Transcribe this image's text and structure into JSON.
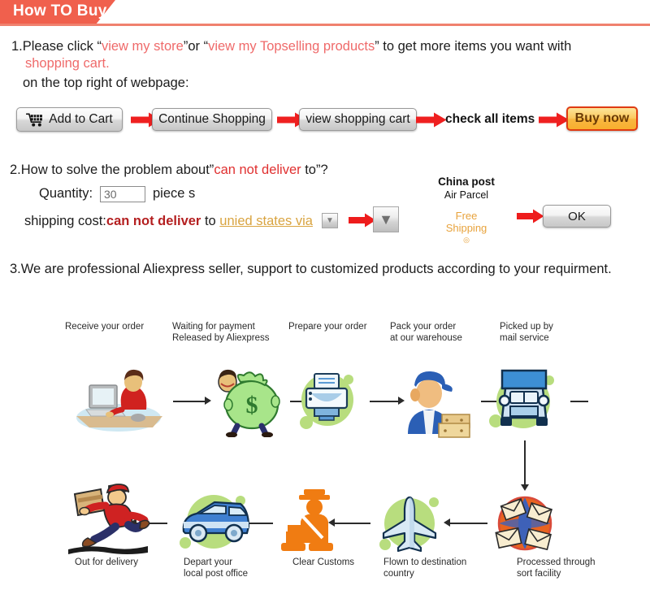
{
  "header": {
    "title": "How TO Buy",
    "accent_color": "#f0604d"
  },
  "step1": {
    "line1_a": "1.Please click “",
    "line1_link1": "view my store",
    "line1_b": "”or “",
    "line1_link2": "view my Topselling products",
    "line1_c": "” to get more items you want with",
    "line2_link": "shopping cart.",
    "line3": "on the top right of webpage:",
    "buttons": [
      {
        "label": "Add to Cart",
        "icon": "shopping-cart-icon",
        "style": "grey"
      },
      {
        "label": "Continue Shopping",
        "icon": "",
        "style": "grey"
      },
      {
        "label": "view shopping cart",
        "icon": "",
        "style": "grey"
      },
      {
        "label": "check all items",
        "icon": "",
        "style": "plain"
      },
      {
        "label": "Buy now",
        "icon": "",
        "style": "orange"
      }
    ]
  },
  "step2": {
    "heading_a": "2.How to solve the problem about”",
    "heading_red": "can not deliver",
    "heading_b": " to”?",
    "quantity_label": "Quantity:",
    "quantity_value": "30",
    "quantity_unit": "piece s",
    "shipping_label": "shipping cost:",
    "shipping_red": "can not deliver",
    "shipping_to": " to ",
    "shipping_country": "unied states via",
    "carrier_name": "China post",
    "carrier_service": "Air Parcel",
    "free_shipping_line1": "Free",
    "free_shipping_line2": "Shipping",
    "ok_button": "OK",
    "dropdown_glyph": "▼",
    "free_shipping_color": "#e8a33d"
  },
  "step3": {
    "text": "3.We are professional Aliexpress seller, support to customized products according to your requirment."
  },
  "flow": {
    "top_row": [
      {
        "label": "Receive your order",
        "icon": "person-at-computer-icon"
      },
      {
        "label": "Waiting for payment\nReleased by Aliexpress",
        "icon": "money-bag-icon"
      },
      {
        "label": "Prepare your order",
        "icon": "printer-icon"
      },
      {
        "label": "Pack your order\nat our warehouse",
        "icon": "warehouse-worker-icon"
      },
      {
        "label": "Picked up by\nmail service",
        "icon": "mail-truck-icon"
      }
    ],
    "bottom_row": [
      {
        "label": "Out for delivery",
        "icon": "running-courier-icon"
      },
      {
        "label": "Depart your\nlocal post office",
        "icon": "delivery-van-icon"
      },
      {
        "label": "Clear Customs",
        "icon": "customs-officer-icon"
      },
      {
        "label": "Flown to destination\ncountry",
        "icon": "airplane-icon"
      },
      {
        "label": "Processed through\nsort facility",
        "icon": "globe-mail-icon"
      }
    ]
  }
}
